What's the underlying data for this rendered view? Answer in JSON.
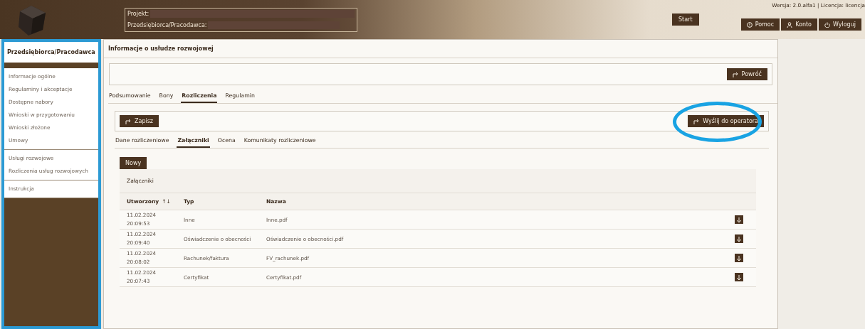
{
  "header": {
    "project_label": "Projekt:",
    "employer_label": "Przedsiębiorca/Pracodawca:",
    "start_button": "Start",
    "version": "Wersja: 2.0.alfa1 | Licencja: licencja",
    "actions": [
      {
        "kind": "help",
        "label": "Pomoc"
      },
      {
        "kind": "account",
        "label": "Konto"
      },
      {
        "kind": "logout",
        "label": "Wyloguj"
      }
    ]
  },
  "sidebar": {
    "title": "Przedsiębiorca/Pracodawca",
    "groups": [
      [
        "Informacje ogólne",
        "Regulaminy i akceptacje",
        "Dostępne nabory",
        "Wnioski w przygotowaniu",
        "Wnioski złożone",
        "Umowy"
      ],
      [
        "Usługi rozwojowe",
        "Rozliczenia usług rozwojowych"
      ],
      [
        "Instrukcja"
      ]
    ]
  },
  "main": {
    "title": "Informacje o usłudze rozwojowej",
    "back_button": "Powróć",
    "tabs": [
      {
        "label": "Podsumowanie",
        "selected": false
      },
      {
        "label": "Bony",
        "selected": false
      },
      {
        "label": "Rozliczenia",
        "selected": true
      },
      {
        "label": "Regulamin",
        "selected": false
      }
    ],
    "save_button": "Zapisz",
    "send_button": "Wyślij do operatora",
    "subtabs": [
      {
        "label": "Dane rozliczeniowe",
        "selected": false
      },
      {
        "label": "Załączniki",
        "selected": true
      },
      {
        "label": "Ocena",
        "selected": false
      },
      {
        "label": "Komunikaty rozliczeniowe",
        "selected": false
      }
    ],
    "new_button": "Nowy",
    "table": {
      "title": "Załączniki",
      "columns": [
        "Utworzony",
        "Typ",
        "Nazwa"
      ],
      "sort_mark": "↑↓",
      "rows": [
        {
          "date": "11.02.2024",
          "time": "20:09:53",
          "type": "Inne",
          "name": "Inne.pdf"
        },
        {
          "date": "11.02.2024",
          "time": "20:09:40",
          "type": "Oświadczenie o obecności",
          "name": "Oświadczenie o obecności.pdf"
        },
        {
          "date": "11.02.2024",
          "time": "20:08:02",
          "type": "Rachunek/faktura",
          "name": "FV_rachunek.pdf"
        },
        {
          "date": "11.02.2024",
          "time": "20:07:43",
          "type": "Certyfikat",
          "name": "Certyfikat.pdf"
        }
      ]
    }
  }
}
